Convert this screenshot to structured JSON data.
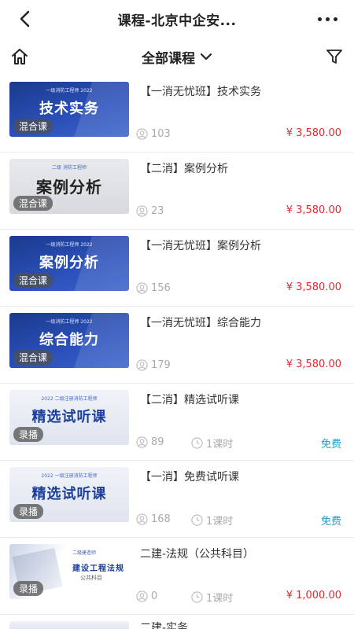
{
  "nav": {
    "title": "课程-北京中企安..."
  },
  "filter": {
    "category": "全部课程"
  },
  "courses": [
    {
      "title": "【一消无忧班】技术实务",
      "thumb_top": "一级消防工程师 2022",
      "thumb_text": "技术实务",
      "badge": "混合课",
      "students": "103",
      "price": "¥ 3,580.00"
    },
    {
      "title": "【二消】案例分析",
      "thumb_top": "二级 消防工程师",
      "thumb_text": "案例分析",
      "badge": "混合课",
      "students": "23",
      "price": "¥ 3,580.00"
    },
    {
      "title": "【一消无忧班】案例分析",
      "thumb_top": "一级消防工程师 2022",
      "thumb_text": "案例分析",
      "badge": "混合课",
      "students": "156",
      "price": "¥ 3,580.00"
    },
    {
      "title": "【一消无忧班】综合能力",
      "thumb_top": "一级消防工程师 2022",
      "thumb_text": "综合能力",
      "badge": "混合课",
      "students": "179",
      "price": "¥ 3,580.00"
    },
    {
      "title": "【二消】精选试听课",
      "thumb_top": "2022 二级注册消防工程师",
      "thumb_text": "精选试听课",
      "badge": "录播",
      "students": "89",
      "duration": "1课时",
      "price": "免费"
    },
    {
      "title": "【一消】免费试听课",
      "thumb_top": "2022 一级注册消防工程师",
      "thumb_text": "精选试听课",
      "badge": "录播",
      "students": "168",
      "duration": "1课时",
      "price": "免费"
    },
    {
      "title": "二建-法规（公共科目）",
      "thumb_top": "二级建造师",
      "thumb_text": "建设工程法规",
      "thumb_sub": "公共科目",
      "badge": "录播",
      "students": "0",
      "duration": "1课时",
      "price": "¥ 1,000.00"
    },
    {
      "title": "二建-实务"
    }
  ],
  "colors": {
    "price": "#e3292e",
    "free": "#1aa0c9",
    "thumb_blue": "#2a4fb8"
  }
}
